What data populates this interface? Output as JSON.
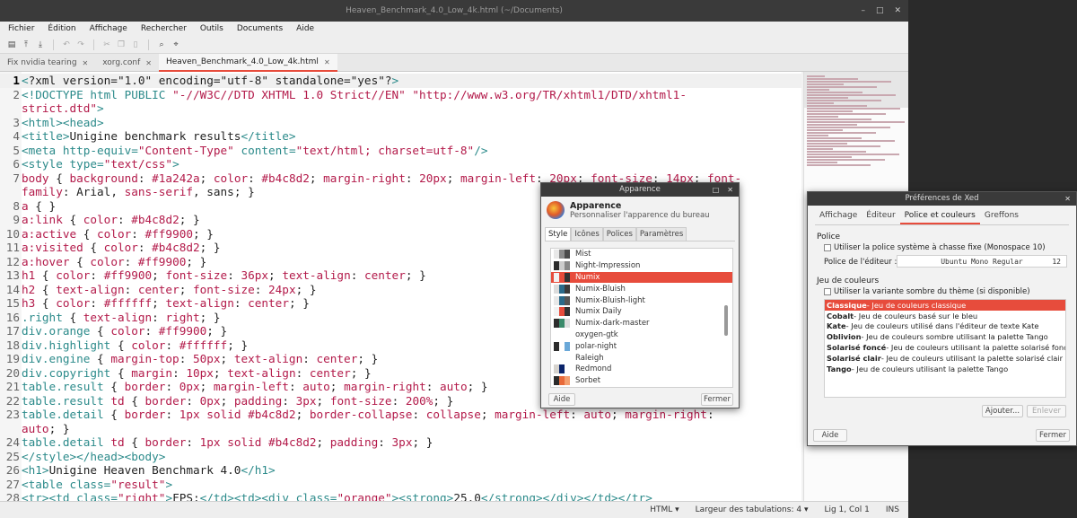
{
  "window": {
    "title": "Heaven_Benchmark_4.0_Low_4k.html (~/Documents)",
    "controls": [
      "–",
      "□",
      "✕"
    ]
  },
  "menu": [
    "Fichier",
    "Édition",
    "Affichage",
    "Rechercher",
    "Outils",
    "Documents",
    "Aide"
  ],
  "tabs": [
    {
      "label": "Fix nvidia tearing",
      "close": "✕"
    },
    {
      "label": "xorg.conf",
      "close": "✕"
    },
    {
      "label": "Heaven_Benchmark_4.0_Low_4k.html",
      "close": "✕"
    }
  ],
  "code_lines": [
    {
      "n": "1",
      "html": "<span class='tag'>&lt;</span>?xml version=\"1.0\" encoding=\"utf-8\" standalone=\"yes\"?<span class='tag'>&gt;</span>"
    },
    {
      "n": "2",
      "html": "<span class='tag'>&lt;!DOCTYPE html PUBLIC</span> <span class='str'>\"-//W3C//DTD XHTML 1.0 Strict//EN\"</span> <span class='str'>\"http://www.w3.org/TR/xhtml1/DTD/xhtml1-</span>"
    },
    {
      "n": "",
      "html": "<span class='str'>strict.dtd\"</span><span class='tag'>&gt;</span>"
    },
    {
      "n": "3",
      "html": "<span class='tag'>&lt;html&gt;&lt;head&gt;</span>"
    },
    {
      "n": "4",
      "html": "<span class='tag'>&lt;title&gt;</span>Unigine benchmark results<span class='tag'>&lt;/title&gt;</span>"
    },
    {
      "n": "5",
      "html": "<span class='tag'>&lt;meta</span> <span class='tag'>http-equiv=</span><span class='str'>\"Content-Type\"</span> <span class='tag'>content=</span><span class='str'>\"text/html; charset=utf-8\"</span><span class='tag'>/&gt;</span>"
    },
    {
      "n": "6",
      "html": "<span class='tag'>&lt;style</span> <span class='tag'>type=</span><span class='str'>\"text/css\"</span><span class='tag'>&gt;</span>"
    },
    {
      "n": "7",
      "html": "<span class='sel'>body</span> { <span class='prop'>background</span>: <span class='val'>#1a242a</span>; <span class='prop'>color</span>: <span class='val'>#b4c8d2</span>; <span class='prop'>margin-right</span>: <span class='val'>20px</span>; <span class='prop'>margin-left</span>: <span class='val'>20px</span>; <span class='prop'>font-size</span>: <span class='val'>14px</span>; <span class='prop'>font-</span>"
    },
    {
      "n": "",
      "html": "<span class='prop'>family</span>: Arial, <span class='val'>sans-serif</span>, sans; }"
    },
    {
      "n": "8",
      "html": "<span class='sel'>a</span> { }"
    },
    {
      "n": "9",
      "html": "<span class='sel'>a:link</span> { <span class='prop'>color</span>: <span class='val'>#b4c8d2</span>; }"
    },
    {
      "n": "10",
      "html": "<span class='sel'>a:active</span> { <span class='prop'>color</span>: <span class='val'>#ff9900</span>; }"
    },
    {
      "n": "11",
      "html": "<span class='sel'>a:visited</span> { <span class='prop'>color</span>: <span class='val'>#b4c8d2</span>; }"
    },
    {
      "n": "12",
      "html": "<span class='sel'>a:hover</span> { <span class='prop'>color</span>: <span class='val'>#ff9900</span>; }"
    },
    {
      "n": "13",
      "html": "<span class='sel'>h1</span> { <span class='prop'>color</span>: <span class='val'>#ff9900</span>; <span class='prop'>font-size</span>: <span class='val'>36px</span>; <span class='prop'>text-align</span>: <span class='val'>center</span>; }"
    },
    {
      "n": "14",
      "html": "<span class='sel'>h2</span> { <span class='prop'>text-align</span>: <span class='val'>center</span>; <span class='prop'>font-size</span>: <span class='val'>24px</span>; }"
    },
    {
      "n": "15",
      "html": "<span class='sel'>h3</span> { <span class='prop'>color</span>: <span class='val'>#ffffff</span>; <span class='prop'>text-align</span>: <span class='val'>center</span>; }"
    },
    {
      "n": "16",
      "html": "<span class='tag'>.right</span> { <span class='prop'>text-align</span>: <span class='val'>right</span>; }"
    },
    {
      "n": "17",
      "html": "<span class='tag'>div.orange</span> { <span class='prop'>color</span>: <span class='val'>#ff9900</span>; }"
    },
    {
      "n": "18",
      "html": "<span class='tag'>div.highlight</span> { <span class='prop'>color</span>: <span class='val'>#ffffff</span>; }"
    },
    {
      "n": "19",
      "html": "<span class='tag'>div.engine</span> { <span class='prop'>margin-top</span>: <span class='val'>50px</span>; <span class='prop'>text-align</span>: <span class='val'>center</span>; }"
    },
    {
      "n": "20",
      "html": "<span class='tag'>div.copyright</span> { <span class='prop'>margin</span>: <span class='val'>10px</span>; <span class='prop'>text-align</span>: <span class='val'>center</span>; }"
    },
    {
      "n": "21",
      "html": "<span class='tag'>table.result</span> { <span class='prop'>border</span>: <span class='val'>0px</span>; <span class='prop'>margin-left</span>: <span class='val'>auto</span>; <span class='prop'>margin-right</span>: <span class='val'>auto</span>; }"
    },
    {
      "n": "22",
      "html": "<span class='tag'>table.result</span> <span class='sel'>td</span> { <span class='prop'>border</span>: <span class='val'>0px</span>; <span class='prop'>padding</span>: <span class='val'>3px</span>; <span class='prop'>font-size</span>: <span class='val'>200%</span>; }"
    },
    {
      "n": "23",
      "html": "<span class='tag'>table.detail</span> { <span class='prop'>border</span>: <span class='val'>1px solid #b4c8d2</span>; <span class='prop'>border-collapse</span>: <span class='val'>collapse</span>; <span class='prop'>margin-left</span>: <span class='val'>auto</span>; <span class='prop'>margin-right</span>:"
    },
    {
      "n": "",
      "html": "<span class='val'>auto</span>; }"
    },
    {
      "n": "24",
      "html": "<span class='tag'>table.detail</span> <span class='sel'>td</span> { <span class='prop'>border</span>: <span class='val'>1px solid #b4c8d2</span>; <span class='prop'>padding</span>: <span class='val'>3px</span>; }"
    },
    {
      "n": "25",
      "html": "<span class='tag'>&lt;/style&gt;&lt;/head&gt;&lt;body&gt;</span>"
    },
    {
      "n": "26",
      "html": "<span class='tag'>&lt;h1&gt;</span>Unigine Heaven Benchmark 4.0<span class='tag'>&lt;/h1&gt;</span>"
    },
    {
      "n": "27",
      "html": "<span class='tag'>&lt;table</span> <span class='tag'>class=</span><span class='str'>\"result\"</span><span class='tag'>&gt;</span>"
    },
    {
      "n": "28",
      "html": "<span class='tag'>&lt;tr&gt;&lt;td</span> <span class='tag'>class=</span><span class='str'>\"right\"</span><span class='tag'>&gt;</span>FPS:<span class='tag'>&lt;/td&gt;&lt;td&gt;&lt;div</span> <span class='tag'>class=</span><span class='str'>\"orange\"</span><span class='tag'>&gt;&lt;strong&gt;</span>25.0<span class='tag'>&lt;/strong&gt;&lt;/div&gt;&lt;/td&gt;&lt;/tr&gt;</span>"
    }
  ],
  "status": {
    "language": "HTML",
    "tab_width": "Largeur des tabulations:  4",
    "position": "Lig 1, Col 1",
    "mode": "INS"
  },
  "appearance": {
    "title": "Apparence",
    "heading": "Apparence",
    "subtitle": "Personnaliser l'apparence du bureau",
    "tabs": [
      "Style",
      "Icônes",
      "Polices",
      "Paramètres"
    ],
    "themes": [
      {
        "name": "Mist",
        "c": [
          "#e8e8e8",
          "#8a8a8a",
          "#4a4a4a"
        ]
      },
      {
        "name": "Night-Impression",
        "c": [
          "#2b2b2b",
          "#cccccc",
          "#888888"
        ]
      },
      {
        "name": "Numix",
        "c": [
          "#f2f2f2",
          "#e74c3c",
          "#333333"
        ]
      },
      {
        "name": "Numix-Bluish",
        "c": [
          "#dcdcdc",
          "#2b6a8a",
          "#3a3a3a"
        ]
      },
      {
        "name": "Numix-Bluish-light",
        "c": [
          "#e8e8e8",
          "#2b6a8a",
          "#555555"
        ]
      },
      {
        "name": "Numix Daily",
        "c": [
          "#f2f2f2",
          "#e74c3c",
          "#333333"
        ]
      },
      {
        "name": "Numix-dark-master",
        "c": [
          "#2d2d2d",
          "#3a8a6a",
          "#dddddd"
        ]
      },
      {
        "name": "oxygen-gtk",
        "c": [
          "#ffffff",
          "#ffffff",
          "#ffffff"
        ]
      },
      {
        "name": "polar-night",
        "c": [
          "#2b2b2b",
          "#ffffff",
          "#6aa8d8"
        ]
      },
      {
        "name": "Raleigh",
        "c": [
          "#ffffff",
          "#ffffff",
          "#ffffff"
        ]
      },
      {
        "name": "Redmond",
        "c": [
          "#d6d3ce",
          "#0a246a",
          "#ffffff"
        ]
      },
      {
        "name": "Sorbet",
        "c": [
          "#2b2b2b",
          "#e86a3a",
          "#f4a070"
        ]
      }
    ],
    "help": "Aide",
    "close": "Fermer"
  },
  "prefs": {
    "title": "Préférences de Xed",
    "tabs": [
      "Affichage",
      "Éditeur",
      "Police et couleurs",
      "Greffons"
    ],
    "police_heading": "Police",
    "system_font": "Utiliser la police système à chasse fixe (Monospace 10)",
    "editor_font_label": "Police de l'éditeur :",
    "editor_font": "Ubuntu Mono Regular",
    "editor_font_size": "12",
    "colors_heading": "Jeu de couleurs",
    "dark_variant": "Utiliser la variante sombre du thème (si disponible)",
    "schemes": [
      {
        "name": "Classique",
        "desc": " - Jeu de couleurs classique"
      },
      {
        "name": "Cobalt",
        "desc": " - Jeu de couleurs basé sur le bleu"
      },
      {
        "name": "Kate",
        "desc": " - Jeu de couleurs utilisé dans l'éditeur de texte Kate"
      },
      {
        "name": "Oblivion",
        "desc": " - Jeu de couleurs sombre utilisant la palette Tango"
      },
      {
        "name": "Solarisé foncé",
        "desc": " - Jeu de couleurs utilisant la palette solarisé foncé"
      },
      {
        "name": "Solarisé clair",
        "desc": " - Jeu de couleurs utilisant la palette solarisé clair"
      },
      {
        "name": "Tango",
        "desc": " - Jeu de couleurs utilisant la palette Tango"
      }
    ],
    "add": "Ajouter...",
    "remove": "Enlever",
    "help": "Aide",
    "close": "Fermer"
  },
  "colors": {
    "accent": "#e74c3c",
    "titlebar": "#3a3a3a"
  }
}
